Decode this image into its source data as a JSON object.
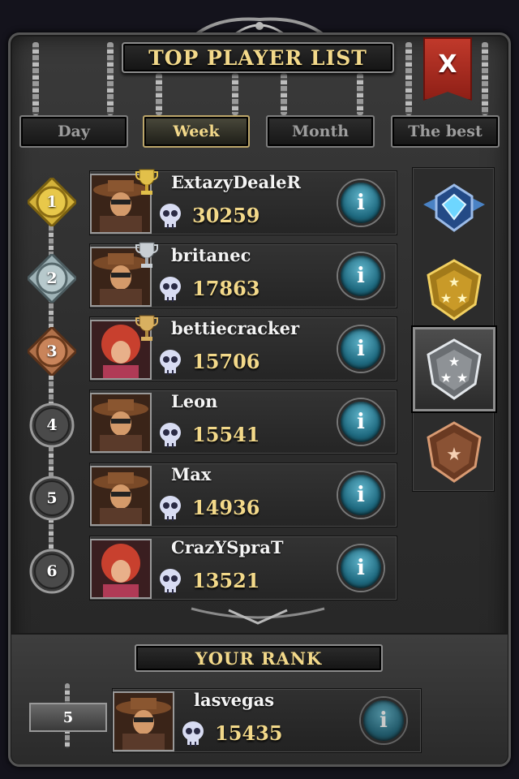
{
  "header": {
    "title": "TOP PLAYER LIST",
    "close_label": "X"
  },
  "tabs": [
    {
      "label": "Day",
      "active": false
    },
    {
      "label": "Week",
      "active": true
    },
    {
      "label": "Month",
      "active": false
    },
    {
      "label": "The best",
      "active": false
    }
  ],
  "players": [
    {
      "rank": "1",
      "name": "ExtazyDealeR",
      "score": "30259",
      "trophy": "gold",
      "avatar": "male"
    },
    {
      "rank": "2",
      "name": "britanec",
      "score": "17863",
      "trophy": "silver",
      "avatar": "male"
    },
    {
      "rank": "3",
      "name": "bettiecracker",
      "score": "15706",
      "trophy": "bronze",
      "avatar": "female"
    },
    {
      "rank": "4",
      "name": "Leon",
      "score": "15541",
      "trophy": "",
      "avatar": "male"
    },
    {
      "rank": "5",
      "name": "Max",
      "score": "14936",
      "trophy": "",
      "avatar": "male"
    },
    {
      "rank": "6",
      "name": "CrazYSpraT",
      "score": "13521",
      "trophy": "",
      "avatar": "female"
    }
  ],
  "info_label": "i",
  "leagues": [
    {
      "icon": "diamond-league-icon"
    },
    {
      "icon": "gold-league-icon"
    },
    {
      "icon": "silver-league-icon",
      "selected": true
    },
    {
      "icon": "bronze-league-icon"
    }
  ],
  "your_rank": {
    "title": "YOUR RANK",
    "rank": "5",
    "name": "lasvegas",
    "score": "15435"
  },
  "colors": {
    "gold_text": "#f3d98a",
    "close_red": "#c0392b",
    "info_blue": "#1f6a80"
  }
}
